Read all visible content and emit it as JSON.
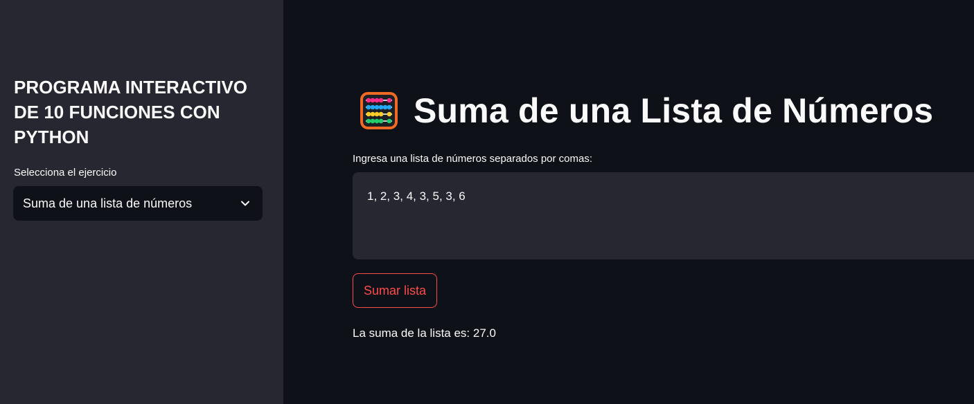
{
  "sidebar": {
    "title": "PROGRAMA INTERACTIVO DE 10 FUNCIONES CON PYTHON",
    "select_label": "Selecciona el ejercicio",
    "select_value": "Suma de una lista de números",
    "select_icon": "chevron-down-icon"
  },
  "main": {
    "header_icon": "abacus-icon",
    "title": "Suma de una Lista de Números",
    "input_label": "Ingresa una lista de números separados por comas:",
    "input_value": "1, 2, 3, 4, 3, 5, 3, 6",
    "button_label": "Sumar lista",
    "result": "La suma de la lista es: 27.0"
  },
  "colors": {
    "sidebar_bg": "#262730",
    "main_bg": "#0e1117",
    "input_bg": "#262730",
    "accent": "#ff4b4b",
    "text": "#fafafa"
  }
}
